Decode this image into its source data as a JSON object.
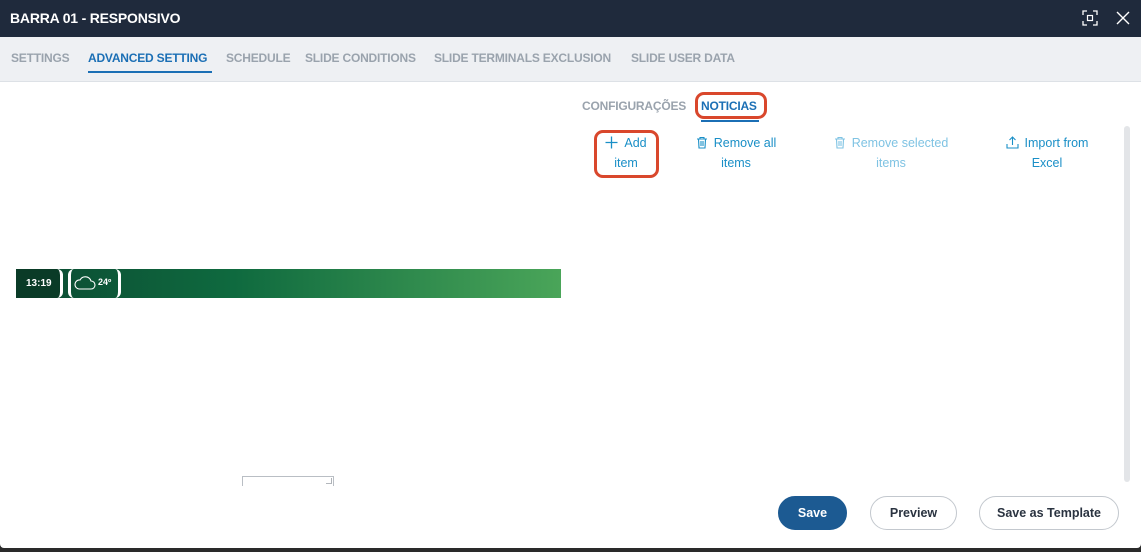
{
  "window": {
    "title": "BARRA 01 - RESPONSIVO",
    "icons": [
      "expand-icon",
      "close-icon"
    ]
  },
  "tabs": [
    {
      "label": "SETTINGS",
      "active": false
    },
    {
      "label": "ADVANCED SETTING",
      "active": true
    },
    {
      "label": "SCHEDULE",
      "active": false
    },
    {
      "label": "SLIDE CONDITIONS",
      "active": false
    },
    {
      "label": "SLIDE TERMINALS EXCLUSION",
      "active": false
    },
    {
      "label": "SLIDE USER DATA",
      "active": false
    }
  ],
  "subtabs": [
    {
      "label": "CONFIGURAÇÕES",
      "active": false
    },
    {
      "label": "NOTICIAS",
      "active": true
    }
  ],
  "actions": {
    "add": {
      "line1": "Add",
      "line2": "item",
      "icon": "plus-icon",
      "enabled": true
    },
    "remove_all": {
      "line1": "Remove all",
      "line2": "items",
      "icon": "trash-icon",
      "enabled": true
    },
    "remove_selected": {
      "line1": "Remove selected",
      "line2": "items",
      "icon": "trash-icon",
      "enabled": false
    },
    "import": {
      "line1": "Import from",
      "line2": "Excel",
      "icon": "upload-icon",
      "enabled": true
    }
  },
  "preview": {
    "time": "13:19",
    "temperature": "24º",
    "weather_icon": "cloud-icon"
  },
  "footer": {
    "save": "Save",
    "preview": "Preview",
    "save_template": "Save as Template"
  },
  "colors": {
    "titlebar": "#1f2a3c",
    "accent": "#1b6fb5",
    "link": "#1a8fc7",
    "highlight": "#d9472c",
    "primary_button": "#1c5a92"
  }
}
